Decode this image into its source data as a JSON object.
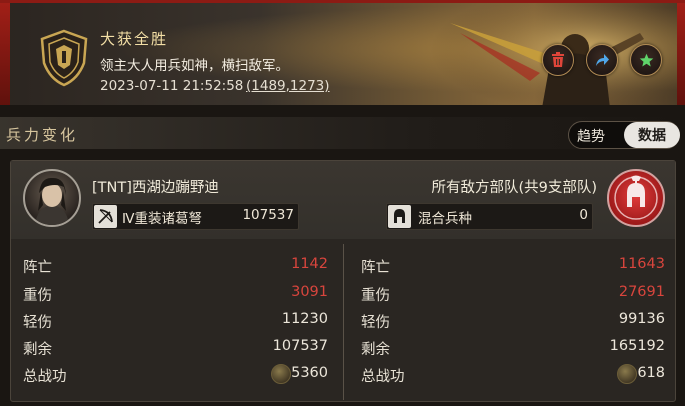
{
  "banner": {
    "title": "大获全胜",
    "subtitle": "领主大人用兵如神，横扫敌军。",
    "datetime": "2023-07-11 21:52:58",
    "coordinates": "(1489,1273)",
    "actions": [
      {
        "name": "delete",
        "icon": "trash-icon",
        "color": "#e0453a"
      },
      {
        "name": "share",
        "icon": "share-arrow-icon",
        "color": "#4fa6e8"
      },
      {
        "name": "favorite",
        "icon": "star-icon",
        "color": "#5fd46a"
      }
    ]
  },
  "section": {
    "title": "兵力变化",
    "tabs": {
      "trend": "趋势",
      "data": "数据"
    },
    "active_tab": "数据"
  },
  "player": {
    "name": "[TNT]西湖边蹦野迪",
    "troop_type": "Ⅳ重装诸葛弩",
    "troop_count": "107537",
    "stats": [
      {
        "label": "阵亡",
        "value": "1142",
        "color": "red"
      },
      {
        "label": "重伤",
        "value": "3091",
        "color": "red"
      },
      {
        "label": "轻伤",
        "value": "11230",
        "color": "white"
      },
      {
        "label": "剩余",
        "value": "107537",
        "color": "white"
      },
      {
        "label": "总战功",
        "value": "5360",
        "color": "white"
      }
    ]
  },
  "enemy": {
    "name": "所有敌方部队(共9支部队)",
    "troop_type": "混合兵种",
    "troop_count": "0",
    "stats": [
      {
        "label": "阵亡",
        "value": "11643",
        "color": "red"
      },
      {
        "label": "重伤",
        "value": "27691",
        "color": "red"
      },
      {
        "label": "轻伤",
        "value": "99136",
        "color": "white"
      },
      {
        "label": "剩余",
        "value": "165192",
        "color": "white"
      },
      {
        "label": "总战功",
        "value": "618",
        "color": "white"
      }
    ]
  },
  "colors": {
    "loss_red": "#d8453d",
    "gold_text": "#f3dfa6",
    "banner_red": "#8c1b14"
  }
}
